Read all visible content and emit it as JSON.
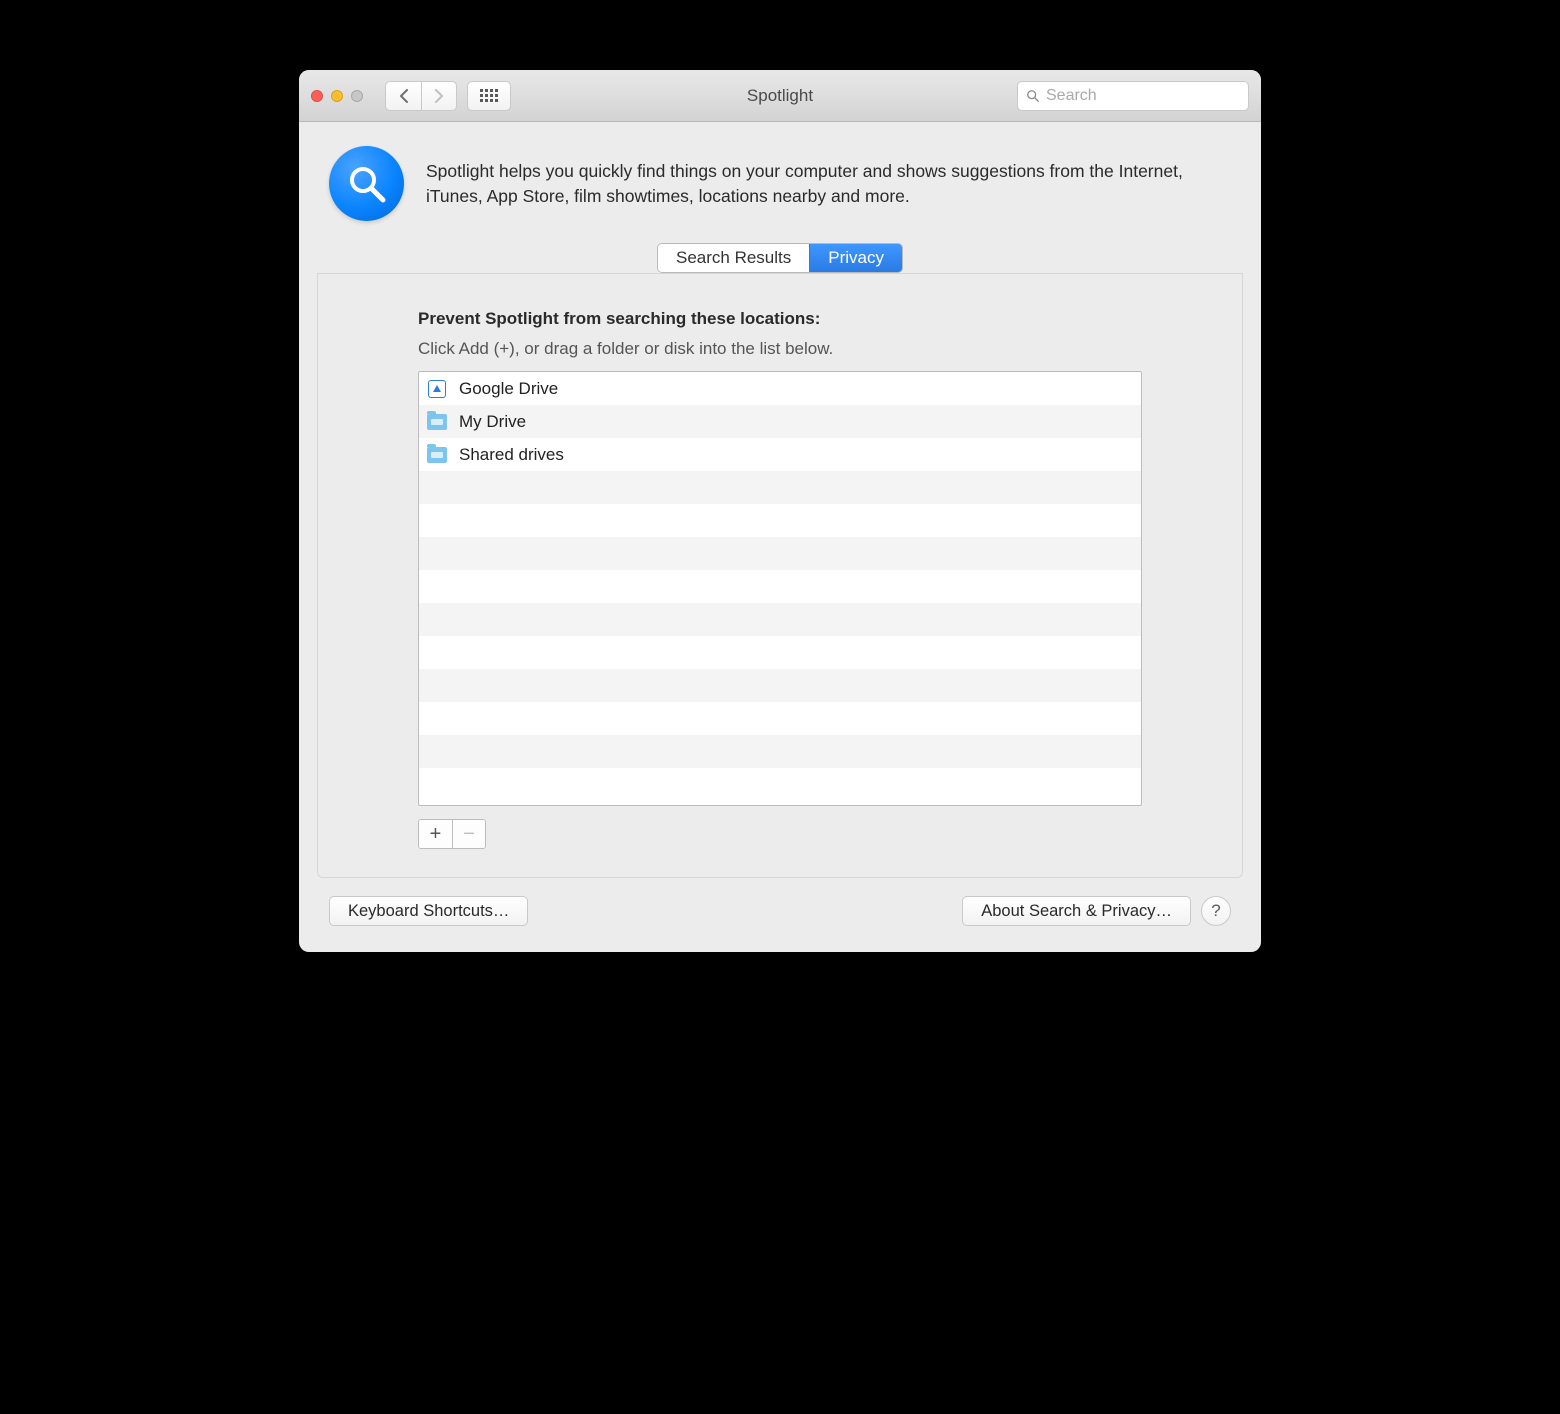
{
  "window": {
    "title": "Spotlight",
    "search_placeholder": "Search"
  },
  "header": {
    "description": "Spotlight helps you quickly find things on your computer and shows suggestions from the Internet, iTunes, App Store, film showtimes, locations nearby and more."
  },
  "tabs": {
    "search_results": "Search Results",
    "privacy": "Privacy",
    "active": "privacy"
  },
  "privacy": {
    "heading": "Prevent Spotlight from searching these locations:",
    "subheading": "Click Add (+), or drag a folder or disk into the list below.",
    "items": [
      {
        "icon": "drive",
        "label": "Google Drive"
      },
      {
        "icon": "folder",
        "label": "My Drive"
      },
      {
        "icon": "folder",
        "label": "Shared drives"
      }
    ],
    "total_rows": 13,
    "add_label": "+",
    "remove_label": "−",
    "remove_enabled": false
  },
  "footer": {
    "keyboard_shortcuts": "Keyboard Shortcuts…",
    "about": "About Search & Privacy…",
    "help": "?"
  }
}
